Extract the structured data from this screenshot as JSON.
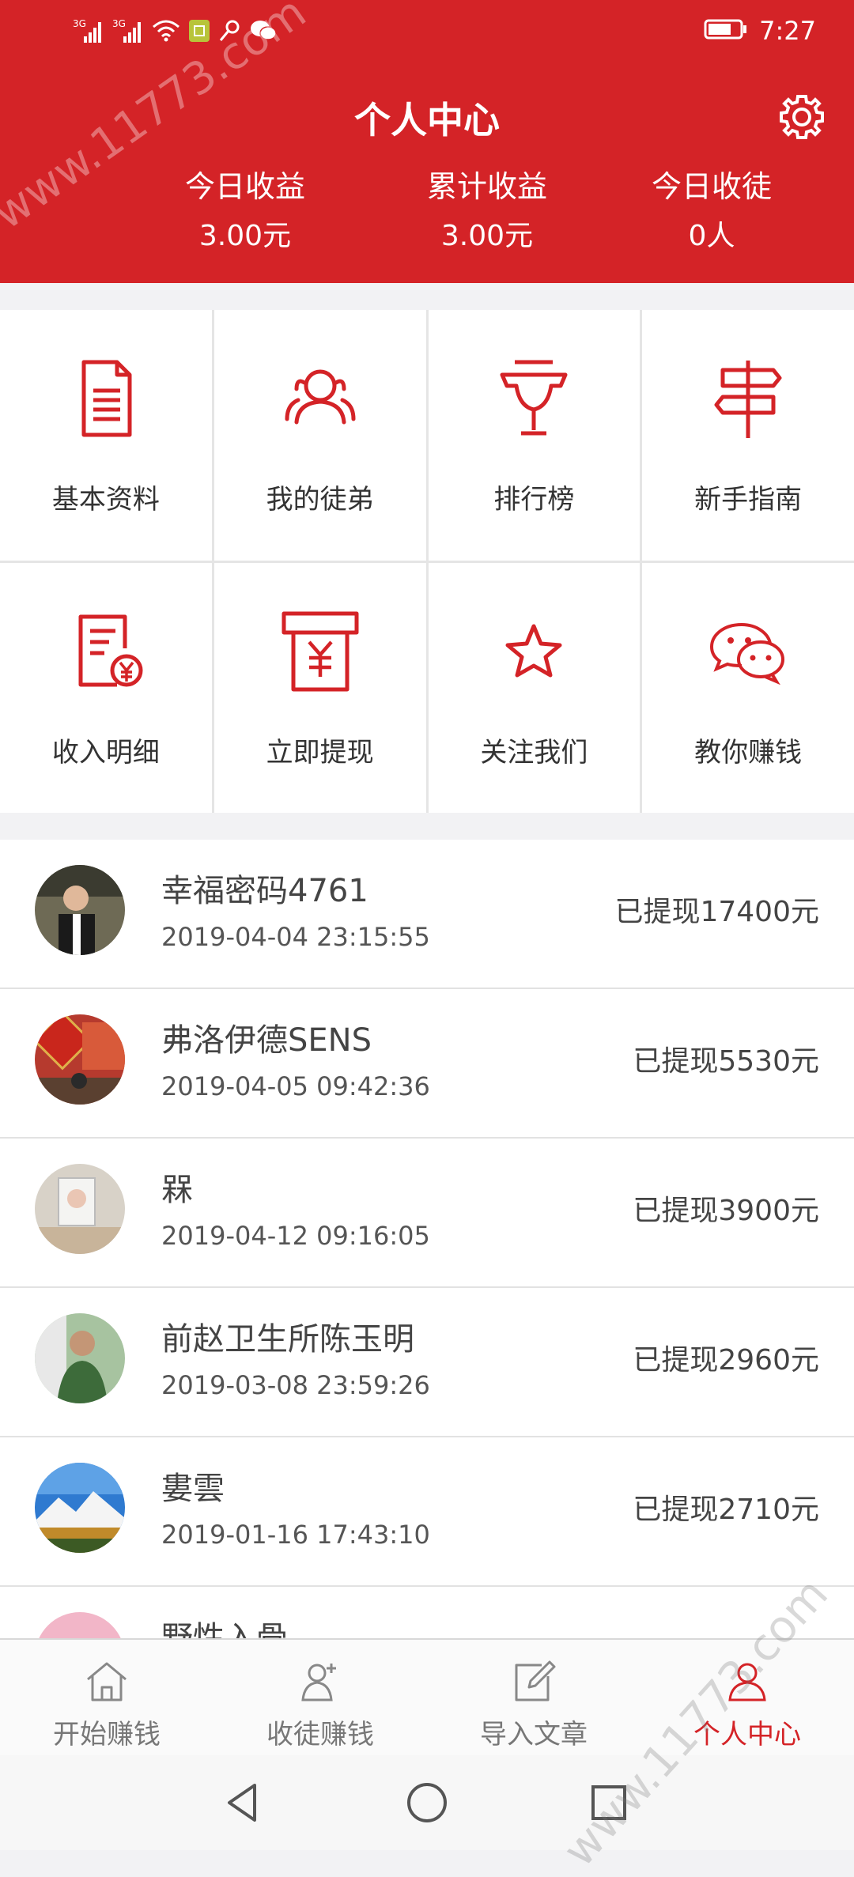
{
  "status_bar": {
    "signal_1": "3G",
    "signal_2": "3G",
    "time": "7:27",
    "icons": [
      "signal-icon",
      "signal-icon",
      "wifi-icon",
      "sim-icon",
      "key-icon",
      "wechat-icon",
      "battery-icon"
    ]
  },
  "header": {
    "title": "个人中心",
    "stats": [
      {
        "label": "今日收益",
        "value": "3.00元"
      },
      {
        "label": "累计收益",
        "value": "3.00元"
      },
      {
        "label": "今日收徒",
        "value": "0人"
      }
    ]
  },
  "menu": [
    {
      "label": "基本资料",
      "icon": "document-icon"
    },
    {
      "label": "我的徒弟",
      "icon": "people-icon"
    },
    {
      "label": "排行榜",
      "icon": "trophy-icon"
    },
    {
      "label": "新手指南",
      "icon": "signpost-icon"
    },
    {
      "label": "收入明细",
      "icon": "income-detail-icon"
    },
    {
      "label": "立即提现",
      "icon": "withdraw-icon"
    },
    {
      "label": "关注我们",
      "icon": "star-icon"
    },
    {
      "label": "教你赚钱",
      "icon": "wechat-chat-icon"
    }
  ],
  "withdrawals": [
    {
      "name": "幸福密码4761",
      "time": "2019-04-04 23:15:55",
      "amount": "已提现17400元"
    },
    {
      "name": "弗洛伊德SENS",
      "time": "2019-04-05 09:42:36",
      "amount": "已提现5530元"
    },
    {
      "name": "槑",
      "time": "2019-04-12 09:16:05",
      "amount": "已提现3900元"
    },
    {
      "name": "前赵卫生所陈玉明",
      "time": "2019-03-08 23:59:26",
      "amount": "已提现2960元"
    },
    {
      "name": "婁雲",
      "time": "2019-01-16 17:43:10",
      "amount": "已提现2710元"
    },
    {
      "name": "野性入骨",
      "time": "",
      "amount": ""
    }
  ],
  "tabs": [
    {
      "label": "开始赚钱",
      "icon": "home-icon",
      "active": false
    },
    {
      "label": "收徒赚钱",
      "icon": "add-user-icon",
      "active": false
    },
    {
      "label": "导入文章",
      "icon": "edit-icon",
      "active": false
    },
    {
      "label": "个人中心",
      "icon": "user-icon",
      "active": true
    }
  ],
  "watermark": "www.11773.com",
  "colors": {
    "brand_red": "#d42327",
    "text": "#333333",
    "tab_inactive": "#777777"
  }
}
